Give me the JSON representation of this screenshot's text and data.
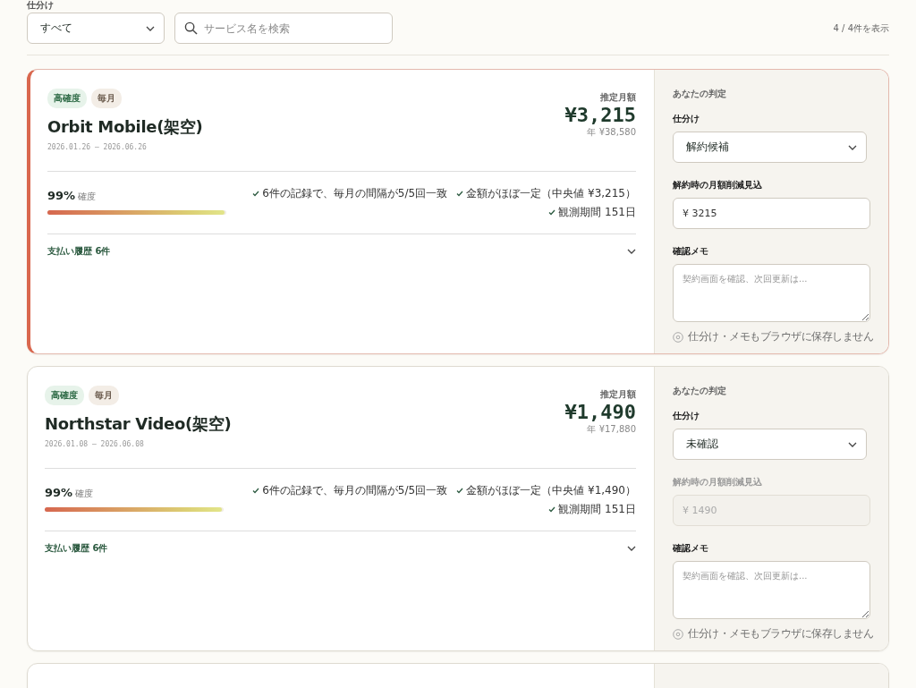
{
  "filter": {
    "label": "仕分け",
    "value": "すべて"
  },
  "search": {
    "placeholder": "サービス名を検索"
  },
  "count": "4 / 4件を表示",
  "cards": [
    {
      "highlighted": true,
      "tags": [
        {
          "label": "高確度",
          "kind": "confidence"
        },
        {
          "label": "毎月",
          "kind": "cycle"
        }
      ],
      "name": "Orbit Mobile(架空)",
      "period": "2026.01.26 – 2026.06.26",
      "amount_label": "推定月額",
      "amount": "¥3,215",
      "yearly": "年 ¥38,580",
      "confidence": "99%",
      "confidence_label": "確度",
      "level": 0.99,
      "reasons": [
        "6件の記録で、毎月の間隔が5/5回一致",
        "金額がほぼ一定（中央値 ¥3,215）",
        "観測期間 151日"
      ],
      "history": "支払い履歴 6件",
      "panel": {
        "title": "あなたの判定",
        "decision_label": "仕分け",
        "decision": "解約候補",
        "savings_label": "解約時の月額削減見込",
        "savings": "¥ 3215",
        "savings_disabled": false,
        "memo_label": "確認メモ",
        "memo_placeholder": "契約画面を確認、次回更新は...",
        "note": "仕分け・メモもブラウザに保存しません"
      }
    },
    {
      "highlighted": false,
      "tags": [
        {
          "label": "高確度",
          "kind": "confidence"
        },
        {
          "label": "毎月",
          "kind": "cycle"
        }
      ],
      "name": "Northstar Video(架空)",
      "period": "2026.01.08 – 2026.06.08",
      "amount_label": "推定月額",
      "amount": "¥1,490",
      "yearly": "年 ¥17,880",
      "confidence": "99%",
      "confidence_label": "確度",
      "level": 0.99,
      "reasons": [
        "6件の記録で、毎月の間隔が5/5回一致",
        "金額がほぼ一定（中央値 ¥1,490）",
        "観測期間 151日"
      ],
      "history": "支払い履歴 6件",
      "panel": {
        "title": "あなたの判定",
        "decision_label": "仕分け",
        "decision": "未確認",
        "savings_label": "解約時の月額削減見込",
        "savings": "¥ 1490",
        "savings_disabled": true,
        "memo_label": "確認メモ",
        "memo_placeholder": "契約画面を確認、次回更新は...",
        "note": "仕分け・メモもブラウザに保存しません"
      }
    }
  ]
}
